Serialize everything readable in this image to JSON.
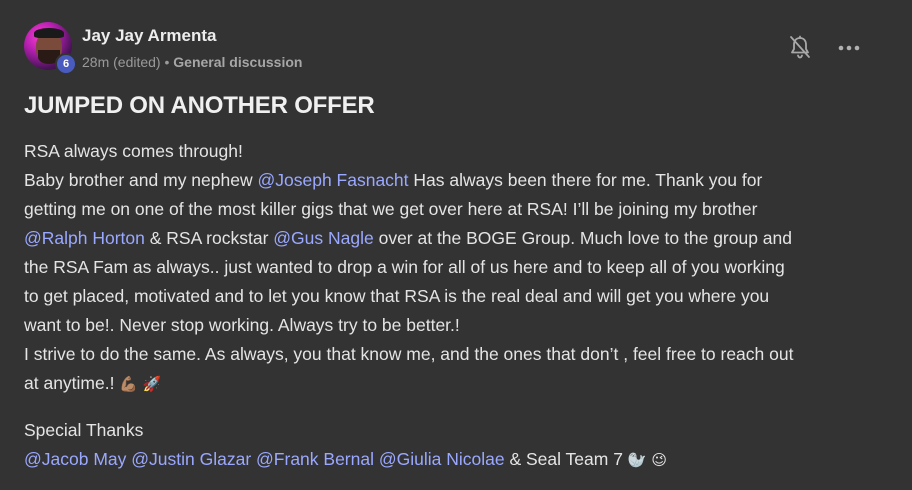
{
  "author": {
    "name": "Jay Jay Armenta",
    "level": "6"
  },
  "meta": {
    "time": "28m (edited)",
    "separator": "•",
    "category": "General discussion"
  },
  "icons": {
    "bell": "bell-off-icon",
    "more": "more-horizontal-icon"
  },
  "post": {
    "title": "JUMPED ON ANOTHER OFFER",
    "line1": "RSA always comes through!",
    "line2_a": "Baby brother and my nephew ",
    "mention_joseph": "@Joseph Fasnacht",
    "line2_b": " Has always been there for me. Thank you for",
    "line3": "getting me on one of the most killer gigs that we get over here at RSA! I’ll be joining my brother",
    "mention_ralph": "@Ralph Horton",
    "line4_a": " & RSA rockstar ",
    "mention_gus": "@Gus Nagle",
    "line4_b": " over at the BOGE Group. Much love to the group and",
    "line5": "the RSA Fam as always.. just wanted to drop a win for all of us here and to keep all of you working",
    "line6": "to get placed, motivated and to let you know that RSA is the real deal and will get you where you",
    "line7": "want to be!. Never stop working. Always try to be better.!",
    "line8": "I strive to do the same. As always, you that know me, and the ones that don’t , feel free to reach out",
    "line9": "at anytime.! ",
    "emoji_muscle": "💪🏽",
    "emoji_rocket": "🚀",
    "thanks_heading": "Special Thanks",
    "mention_jacob": "@Jacob May",
    "mention_justin": "@Justin Glazar",
    "mention_frank": "@Frank Bernal",
    "mention_giulia": "@Giulia Nicolae",
    "thanks_tail": " & Seal Team 7 ",
    "emoji_seal": "🦭",
    "emoji_wink": "😉"
  },
  "colors": {
    "background": "#333333",
    "mention": "#9aa8ff",
    "badge": "#4a5bbf"
  }
}
